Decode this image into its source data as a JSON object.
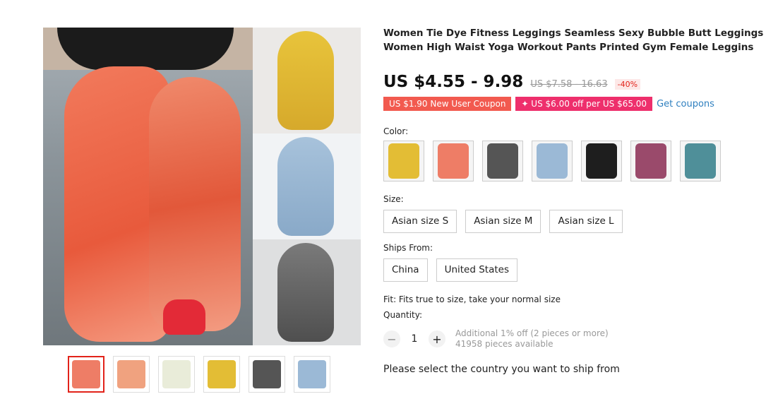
{
  "product": {
    "title": "Women Tie Dye Fitness Leggings Seamless Sexy Bubble Butt Leggings Women High Waist Yoga Workout Pants Printed Gym Female Leggins",
    "price": "US $4.55 - 9.98",
    "original_price": "US $7.58 - 16.63",
    "discount": "-40%"
  },
  "coupons": {
    "new_user": "US $1.90 New User Coupon",
    "store": "✦ US $6.00 off per US $65.00",
    "get_coupons": "Get coupons"
  },
  "color": {
    "label": "Color:",
    "options": [
      "yellow",
      "orange-red",
      "dark-grey",
      "light-blue",
      "black-top",
      "purple-top",
      "teal-top"
    ],
    "colors": [
      "#e3bd35",
      "#ee7d66",
      "#555555",
      "#9bb9d6",
      "#1e1e1e",
      "#9a4a6b",
      "#4f8f99"
    ]
  },
  "size": {
    "label": "Size:",
    "options": [
      "Asian size S",
      "Asian size M",
      "Asian size L"
    ]
  },
  "ships_from": {
    "label": "Ships From:",
    "options": [
      "China",
      "United States"
    ]
  },
  "fit": "Fit: Fits true to size, take your normal size",
  "quantity": {
    "label": "Quantity:",
    "minus": "−",
    "value": "1",
    "plus": "+",
    "note1": "Additional 1% off (2 pieces or more)",
    "note2": "41958 pieces available"
  },
  "ship_note": "Please select the country you want to ship from",
  "thumb_colors": [
    "#ee7d66",
    "#f0a27f",
    "#e9ecd9",
    "#e3bd35",
    "#555555",
    "#9bb9d6"
  ]
}
